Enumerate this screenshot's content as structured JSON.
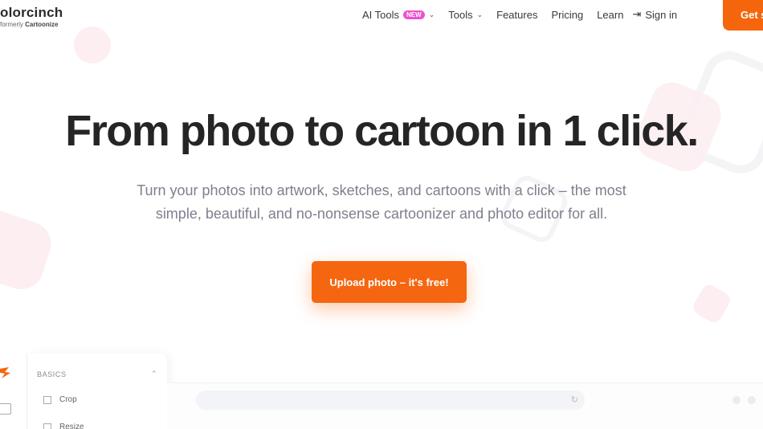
{
  "brand": {
    "name": "olorcinch",
    "sub_prefix": "formerly",
    "sub_name": "Cartoonize",
    "accent": "#f5660c"
  },
  "nav": {
    "items": [
      {
        "label": "AI Tools",
        "badge": "NEW",
        "dropdown": true
      },
      {
        "label": "Tools",
        "dropdown": true
      },
      {
        "label": "Features"
      },
      {
        "label": "Pricing"
      },
      {
        "label": "Learn"
      }
    ],
    "signin": "Sign in",
    "cta": "Get s"
  },
  "hero": {
    "title": "From photo to cartoon in 1 click.",
    "subtitle": "Turn your photos into artwork, sketches, and cartoons with a click – the most simple, beautiful, and no-nonsense cartoonizer and photo editor for all.",
    "cta": "Upload photo – it's free!"
  },
  "editor": {
    "section": "BASICS",
    "tools": [
      "Crop",
      "Resize"
    ]
  },
  "icons": [
    "chevron-down-icon",
    "sign-in-icon",
    "chevron-up-icon",
    "crop-icon",
    "resize-icon",
    "image-icon",
    "reload-icon",
    "brand-logo-icon"
  ]
}
